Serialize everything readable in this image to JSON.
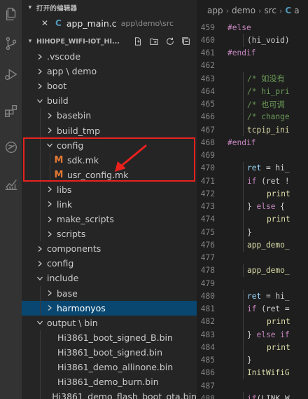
{
  "activity_bar": {
    "icons": [
      "files-icon",
      "search-icon",
      "source-control-icon",
      "run-debug-icon",
      "extensions-icon",
      "remote-icon",
      "chart-icon"
    ]
  },
  "open_editors": {
    "title": "打开的编辑器",
    "items": [
      {
        "close": "✕",
        "icon_letter": "C",
        "name": "app_main.c",
        "path": "app\\demo\\src"
      }
    ]
  },
  "workspace": {
    "title": "HIHOPE_WIFI-IOT_HI...",
    "tree": [
      {
        "label": ".vscode",
        "kind": "folder",
        "state": "closed",
        "depth": 1
      },
      {
        "label": "app \\ demo",
        "kind": "folder",
        "state": "closed",
        "depth": 1
      },
      {
        "label": "boot",
        "kind": "folder",
        "state": "closed",
        "depth": 1
      },
      {
        "label": "build",
        "kind": "folder",
        "state": "open",
        "depth": 1
      },
      {
        "label": "basebin",
        "kind": "folder",
        "state": "closed",
        "depth": 2
      },
      {
        "label": "build_tmp",
        "kind": "folder",
        "state": "closed",
        "depth": 2
      },
      {
        "label": "config",
        "kind": "folder",
        "state": "open",
        "depth": 2
      },
      {
        "label": "sdk.mk",
        "kind": "file-m",
        "depth": 3
      },
      {
        "label": "usr_config.mk",
        "kind": "file-m",
        "depth": 3
      },
      {
        "label": "libs",
        "kind": "folder",
        "state": "closed",
        "depth": 2
      },
      {
        "label": "link",
        "kind": "folder",
        "state": "closed",
        "depth": 2
      },
      {
        "label": "make_scripts",
        "kind": "folder",
        "state": "closed",
        "depth": 2
      },
      {
        "label": "scripts",
        "kind": "folder",
        "state": "closed",
        "depth": 2
      },
      {
        "label": "components",
        "kind": "folder",
        "state": "closed",
        "depth": 1
      },
      {
        "label": "config",
        "kind": "folder",
        "state": "closed",
        "depth": 1
      },
      {
        "label": "include",
        "kind": "folder",
        "state": "open",
        "depth": 1
      },
      {
        "label": "base",
        "kind": "folder",
        "state": "closed",
        "depth": 2
      },
      {
        "label": "harmonyos",
        "kind": "folder",
        "state": "closed",
        "depth": 2,
        "selected": true
      },
      {
        "label": "output \\ bin",
        "kind": "folder",
        "state": "open",
        "depth": 1
      },
      {
        "label": "Hi3861_boot_signed_B.bin",
        "kind": "file-bin",
        "depth": 2
      },
      {
        "label": "Hi3861_boot_signed.bin",
        "kind": "file-bin",
        "depth": 2
      },
      {
        "label": "Hi3861_demo_allinone.bin",
        "kind": "file-bin",
        "depth": 2
      },
      {
        "label": "Hi3861_demo_burn.bin",
        "kind": "file-bin",
        "depth": 2
      },
      {
        "label": "Hi3861_demo_flash_boot_ota.bin",
        "kind": "file-bin",
        "depth": 2
      }
    ]
  },
  "editor": {
    "breadcrumb": [
      "app",
      "demo",
      "src",
      "C",
      "a"
    ],
    "lines": [
      {
        "n": "459",
        "indent": 0,
        "tokens": [
          {
            "t": "#else",
            "c": "kw-dir"
          }
        ]
      },
      {
        "n": "460",
        "indent": 1,
        "tokens": [
          {
            "t": "(hi_void)",
            "c": "pl"
          }
        ]
      },
      {
        "n": "461",
        "indent": 0,
        "tokens": [
          {
            "t": "#endif",
            "c": "kw-dir"
          }
        ]
      },
      {
        "n": "462",
        "indent": 0,
        "tokens": []
      },
      {
        "n": "463",
        "indent": 1,
        "tokens": [
          {
            "t": "/* 如没有",
            "c": "cm"
          }
        ]
      },
      {
        "n": "464",
        "indent": 1,
        "tokens": [
          {
            "t": "/* hi_pri",
            "c": "cm"
          }
        ]
      },
      {
        "n": "465",
        "indent": 1,
        "tokens": [
          {
            "t": "/* 也可调",
            "c": "cm"
          }
        ]
      },
      {
        "n": "466",
        "indent": 1,
        "tokens": [
          {
            "t": "/* change",
            "c": "cm"
          }
        ]
      },
      {
        "n": "467",
        "indent": 1,
        "tokens": [
          {
            "t": "tcpip_ini",
            "c": "fn"
          }
        ]
      },
      {
        "n": "468",
        "indent": 0,
        "tokens": [
          {
            "t": "#endif",
            "c": "kw-dir"
          }
        ]
      },
      {
        "n": "469",
        "indent": 0,
        "tokens": []
      },
      {
        "n": "470",
        "indent": 1,
        "tokens": [
          {
            "t": "ret",
            "c": "var"
          },
          {
            "t": " = hi_",
            "c": "pl"
          }
        ]
      },
      {
        "n": "471",
        "indent": 1,
        "tokens": [
          {
            "t": "if",
            "c": "kw-dir"
          },
          {
            "t": " (ret !",
            "c": "pl"
          }
        ]
      },
      {
        "n": "472",
        "indent": 2,
        "tokens": [
          {
            "t": "print",
            "c": "fn"
          }
        ]
      },
      {
        "n": "473",
        "indent": 1,
        "tokens": [
          {
            "t": "} ",
            "c": "pl"
          },
          {
            "t": "else",
            "c": "kw-dir"
          },
          {
            "t": " {",
            "c": "pl"
          }
        ]
      },
      {
        "n": "474",
        "indent": 2,
        "tokens": [
          {
            "t": "print",
            "c": "fn"
          }
        ]
      },
      {
        "n": "475",
        "indent": 1,
        "tokens": [
          {
            "t": "}",
            "c": "pl"
          }
        ]
      },
      {
        "n": "476",
        "indent": 1,
        "tokens": [
          {
            "t": "app_demo_",
            "c": "fn"
          }
        ]
      },
      {
        "n": "477",
        "indent": 0,
        "tokens": []
      },
      {
        "n": "478",
        "indent": 1,
        "tokens": [
          {
            "t": "app_demo_",
            "c": "fn"
          }
        ]
      },
      {
        "n": "479",
        "indent": 0,
        "tokens": []
      },
      {
        "n": "480",
        "indent": 1,
        "tokens": [
          {
            "t": "ret",
            "c": "var"
          },
          {
            "t": " = hi_",
            "c": "pl"
          }
        ]
      },
      {
        "n": "481",
        "indent": 1,
        "tokens": [
          {
            "t": "if",
            "c": "kw-dir"
          },
          {
            "t": " (ret =",
            "c": "pl"
          }
        ]
      },
      {
        "n": "482",
        "indent": 2,
        "tokens": [
          {
            "t": "print",
            "c": "fn"
          }
        ]
      },
      {
        "n": "483",
        "indent": 1,
        "tokens": [
          {
            "t": "} ",
            "c": "pl"
          },
          {
            "t": "else if",
            "c": "kw-dir"
          }
        ]
      },
      {
        "n": "484",
        "indent": 2,
        "tokens": [
          {
            "t": "print",
            "c": "fn"
          }
        ]
      },
      {
        "n": "485",
        "indent": 1,
        "tokens": [
          {
            "t": "}",
            "c": "pl"
          }
        ]
      },
      {
        "n": "486",
        "indent": 1,
        "tokens": [
          {
            "t": "InitWifiG",
            "c": "fn"
          }
        ]
      },
      {
        "n": "487",
        "indent": 0,
        "tokens": []
      },
      {
        "n": "488",
        "indent": 1,
        "tokens": [
          {
            "t": "if",
            "c": "kw-dir"
          },
          {
            "t": "(LINK W",
            "c": "pl"
          }
        ]
      }
    ]
  },
  "annotation": {
    "color": "#e8211d"
  }
}
